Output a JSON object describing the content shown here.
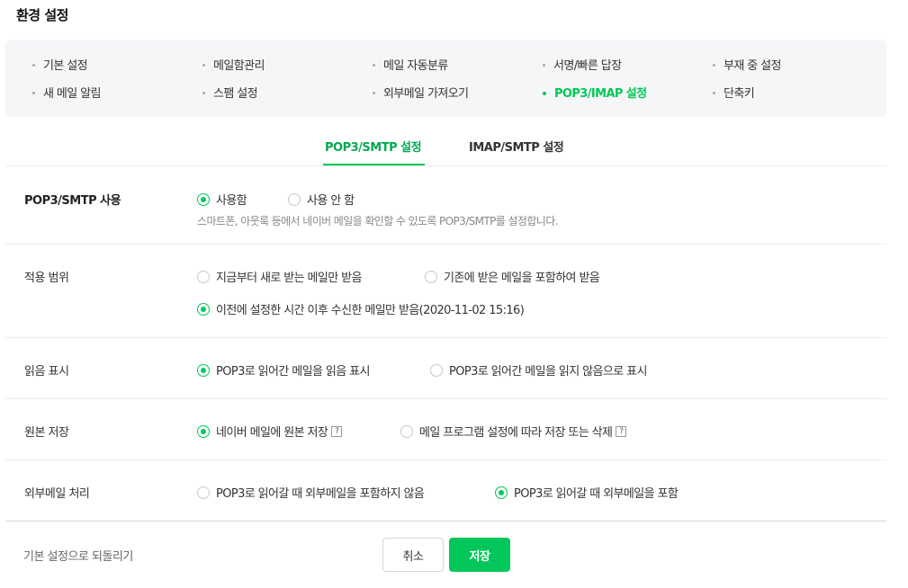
{
  "page": {
    "title": "환경 설정"
  },
  "menu": {
    "items": [
      {
        "label": "기본 설정"
      },
      {
        "label": "메일함관리"
      },
      {
        "label": "메일 자동분류"
      },
      {
        "label": "서명/빠른 답장"
      },
      {
        "label": "부재 중 설정"
      },
      {
        "label": "새 메일 알림"
      },
      {
        "label": "스팸 설정"
      },
      {
        "label": "외부메일 가져오기"
      },
      {
        "label": "POP3/IMAP 설정",
        "active": true
      },
      {
        "label": "단축키"
      }
    ]
  },
  "tabs": [
    {
      "label": "POP3/SMTP 설정",
      "active": true
    },
    {
      "label": "IMAP/SMTP 설정",
      "active": false
    }
  ],
  "settings": {
    "use": {
      "label": "POP3/SMTP 사용",
      "options": [
        "사용함",
        "사용 안 함"
      ],
      "selected": "사용함",
      "description": "스마트폰, 아웃룩 등에서 네이버 메일을 확인할 수 있도록 POP3/SMTP를 설정합니다."
    },
    "scope": {
      "label": "적용 범위",
      "options": [
        "지금부터 새로 받는 메일만 받음",
        "기존에 받은 메일을 포함하여 받음",
        "이전에 설정한 시간 이후 수신한 메일만 받음(2020-11-02 15:16)"
      ],
      "selected": "이전에 설정한 시간 이후 수신한 메일만 받음(2020-11-02 15:16)"
    },
    "read_mark": {
      "label": "읽음 표시",
      "options": [
        "POP3로 읽어간 메일을 읽음 표시",
        "POP3로 읽어간 메일을 읽지 않음으로 표시"
      ],
      "selected": "POP3로 읽어간 메일을 읽음 표시"
    },
    "original": {
      "label": "원본 저장",
      "options": [
        "네이버 메일에 원본 저장",
        "메일 프로그램 설정에 따라 저장 또는 삭제"
      ],
      "selected": "네이버 메일에 원본 저장",
      "help_glyph": "?"
    },
    "external": {
      "label": "외부메일 처리",
      "options": [
        "POP3로 읽어갈 때 외부메일을 포함하지 않음",
        "POP3로 읽어갈 때 외부메일을 포함"
      ],
      "selected": "POP3로 읽어갈 때 외부메일을 포함"
    }
  },
  "footer": {
    "reset_label": "기본 설정으로 되돌리기",
    "cancel_label": "취소",
    "save_label": "저장"
  },
  "colors": {
    "accent": "#03c75a",
    "menu_bg": "#f5f6f8"
  }
}
